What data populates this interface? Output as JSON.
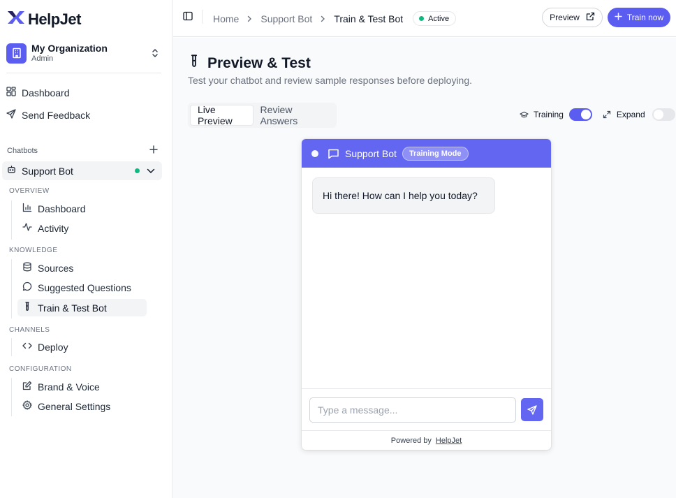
{
  "brand": {
    "name": "HelpJet",
    "logo_icon": "x-logo-icon",
    "accent": "#5b5cf0"
  },
  "org": {
    "name": "My Organization",
    "role": "Admin"
  },
  "nav_top": [
    {
      "label": "Dashboard",
      "icon": "layout-grid-icon"
    },
    {
      "label": "Send Feedback",
      "icon": "send-icon"
    }
  ],
  "chatbots": {
    "label": "Chatbots",
    "bot_name": "Support Bot",
    "status_color": "#10b981"
  },
  "sections": {
    "overview": "OVERVIEW",
    "knowledge": "KNOWLEDGE",
    "channels": "CHANNELS",
    "configuration": "CONFIGURATION"
  },
  "sub_nav": {
    "dashboard": "Dashboard",
    "activity": "Activity",
    "sources": "Sources",
    "suggested_questions": "Suggested Questions",
    "train_test": "Train & Test Bot",
    "deploy": "Deploy",
    "brand_voice": "Brand & Voice",
    "general_settings": "General Settings"
  },
  "topbar": {
    "crumbs": [
      "Home",
      "Support Bot",
      "Train & Test Bot"
    ],
    "status": "Active",
    "preview_label": "Preview",
    "train_label": "Train now"
  },
  "page": {
    "title": "Preview & Test",
    "subtitle": "Test your chatbot and review sample responses before deploying.",
    "tabs": [
      "Live Preview",
      "Review Answers"
    ],
    "training_label": "Training",
    "training_on": true,
    "expand_label": "Expand",
    "expand_on": false
  },
  "widget": {
    "title": "Support Bot",
    "badge": "Training Mode",
    "header_color": "#6366f1",
    "greeting": "Hi there! How can I help you today?",
    "input_placeholder": "Type a message...",
    "powered_by": "Powered by",
    "powered_brand": "HelpJet"
  }
}
